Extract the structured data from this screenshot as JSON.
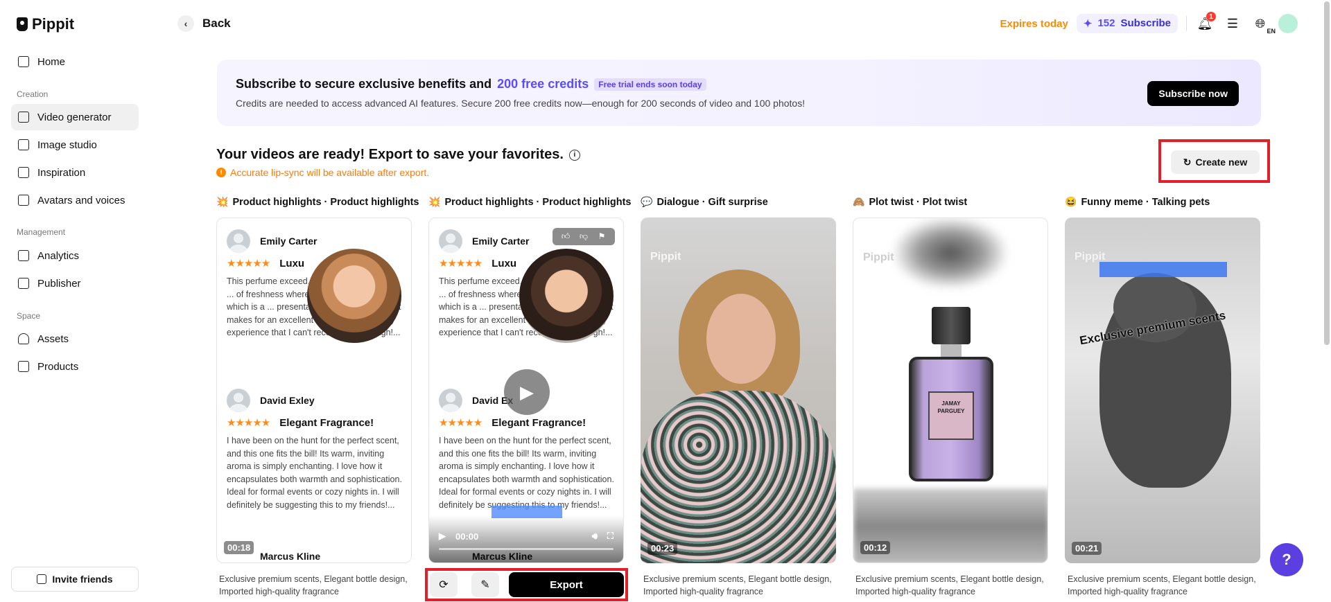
{
  "app": {
    "name": "Pippit"
  },
  "sidebar": {
    "items": [
      {
        "label": "Home",
        "icon": "home-icon"
      },
      {
        "label": "Video generator",
        "icon": "video-icon"
      },
      {
        "label": "Image studio",
        "icon": "image-icon"
      },
      {
        "label": "Inspiration",
        "icon": "inspiration-icon"
      },
      {
        "label": "Avatars and voices",
        "icon": "avatar-icon"
      },
      {
        "label": "Analytics",
        "icon": "analytics-icon"
      },
      {
        "label": "Publisher",
        "icon": "calendar-icon"
      },
      {
        "label": "Assets",
        "icon": "cloud-icon"
      },
      {
        "label": "Products",
        "icon": "products-icon"
      }
    ],
    "sections": {
      "creation": "Creation",
      "management": "Management",
      "space": "Space"
    },
    "invite": "Invite friends"
  },
  "header": {
    "back": "Back",
    "expires": "Expires today",
    "credits": "152",
    "subscribe": "Subscribe",
    "notifications": "1",
    "language": "EN"
  },
  "banner": {
    "title_pre": "Subscribe to secure exclusive benefits and",
    "title_accent": "200 free credits",
    "trial": "Free trial ends soon today",
    "subtitle": "Credits are needed to access advanced AI features. Secure 200 free credits now—enough for 200 seconds of video and 100 photos!",
    "cta": "Subscribe now"
  },
  "main": {
    "heading": "Your videos are ready! Export to save your favorites.",
    "warning": "Accurate lip-sync will be available after export.",
    "create_new": "Create new",
    "export": "Export"
  },
  "cards": [
    {
      "title": "Product highlights · Product highlights",
      "emoji": "💥",
      "duration": "00:18",
      "desc": "Exclusive premium scents, Elegant bottle design, Imported high-quality fragrance"
    },
    {
      "title": "Product highlights · Product highlights",
      "emoji": "💥",
      "duration": "00:00",
      "desc": ""
    },
    {
      "title": "Dialogue · Gift surprise",
      "emoji": "💬",
      "duration": "00:23",
      "desc": "Exclusive premium scents, Elegant bottle design, Imported high-quality fragrance"
    },
    {
      "title": "Plot twist · Plot twist",
      "emoji": "🙈",
      "duration": "00:12",
      "desc": "Exclusive premium scents, Elegant bottle design, Imported high-quality fragrance"
    },
    {
      "title": "Funny meme · Talking pets",
      "emoji": "😆",
      "duration": "00:21",
      "desc": "Exclusive premium scents, Elegant bottle design, Imported high-quality fragrance"
    }
  ],
  "reviews": {
    "r1_name": "Emily Carter",
    "r1_stars": "★★★★★",
    "r1_head": "Luxu",
    "r1_text": "This perfume exceed... The scent is rich and ... of freshness wherever ... without fading, which is a ... presentation was stunning too; it makes for an excellent gift. Overall, a luxury experience that I can't recommend enough!...",
    "r2_name": "David Exley",
    "r2_name_short": "David Ex",
    "r2_stars": "★★★★★",
    "r2_head": "Elegant Fragrance!",
    "r2_text": "I have been on the hunt for the perfect scent, and this one fits the bill! Its warm, inviting aroma is simply enchanting. I love how it encapsulates both warmth and sophistication. Ideal for formal events or cozy nights in. I will definitely be suggesting this to my friends!...",
    "r3_name": "Marcus Kline"
  },
  "video_overlays": {
    "watermark": "Pippit",
    "bottle_label": "JAMAY PARGUEY",
    "cat_caption": "Exclusive premium scents"
  },
  "colors": {
    "accent": "#5b4bff",
    "warning": "#ff7a00",
    "highlight_border": "#e0202a"
  }
}
